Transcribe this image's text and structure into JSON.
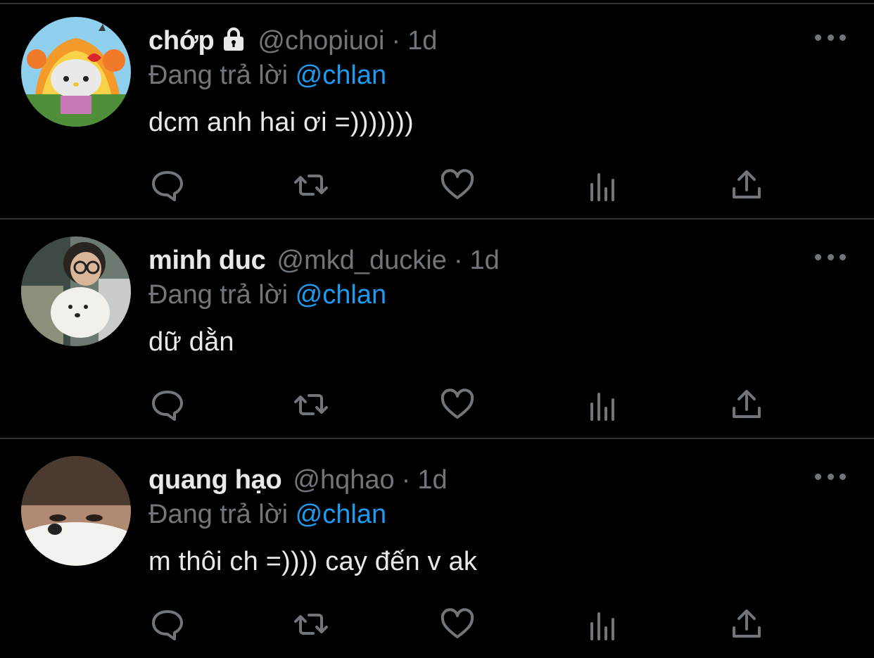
{
  "tweets": [
    {
      "name": "chớp",
      "locked": true,
      "handle": "@chopiuoi",
      "time": "1d",
      "reply_prefix": "Đang trả lời",
      "reply_to": "@chlan",
      "text": "dcm anh hai ơi =)))))))",
      "avatar_icon": "hello-kitty-explosion-avatar"
    },
    {
      "name": "minh duc",
      "locked": false,
      "handle": "@mkd_duckie",
      "time": "1d",
      "reply_prefix": "Đang trả lời",
      "reply_to": "@chlan",
      "text": "dữ dằn",
      "avatar_icon": "person-with-dog-avatar"
    },
    {
      "name": "quang hạo",
      "locked": false,
      "handle": "@hqhao",
      "time": "1d",
      "reply_prefix": "Đang trả lời",
      "reply_to": "@chlan",
      "text": "m thôi ch =)))) cay đến v ak",
      "avatar_icon": "person-face-avatar"
    }
  ],
  "separator": "·",
  "actions": [
    "reply-icon",
    "retweet-icon",
    "like-icon",
    "analytics-icon",
    "share-icon"
  ],
  "colors": {
    "background": "#000000",
    "text_primary": "#e7e9ea",
    "text_secondary": "#71767b",
    "accent": "#1d9bf0",
    "divider": "#2f3336"
  }
}
